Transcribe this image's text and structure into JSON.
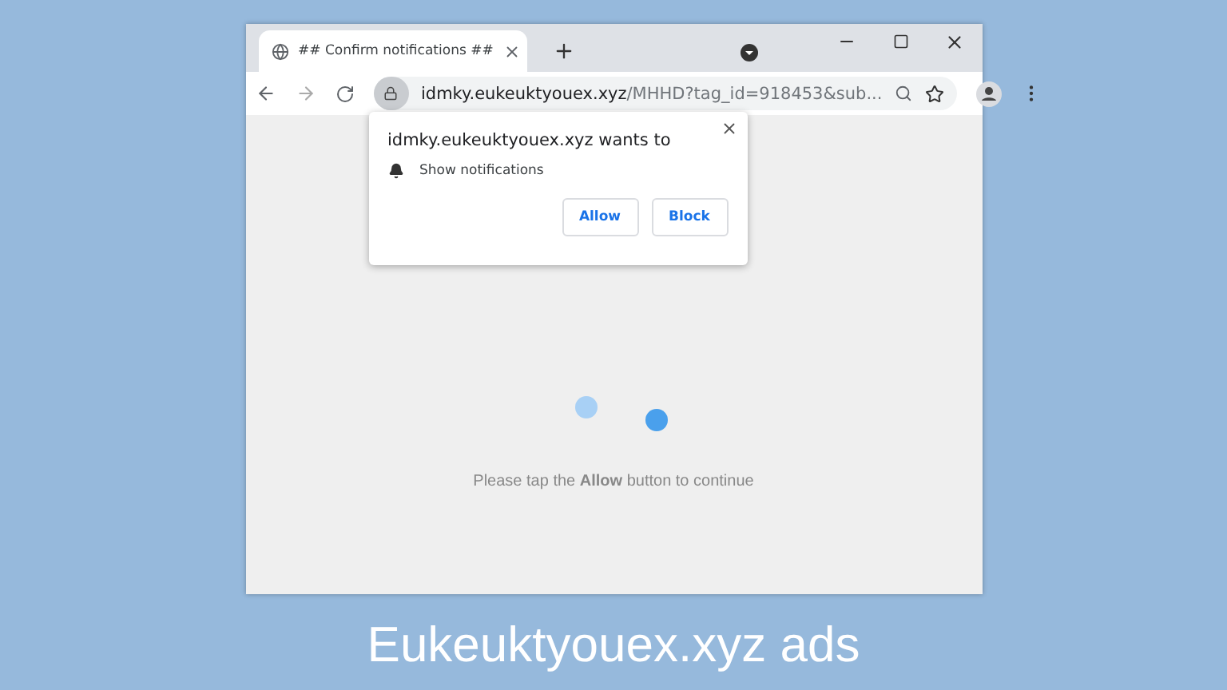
{
  "tab": {
    "title": "## Confirm notifications ##",
    "selected": true
  },
  "address_bar": {
    "host": "idmky.eukeuktyouex.xyz",
    "path": "/MHHD?tag_id=918453&sub..."
  },
  "permission_popup": {
    "title": "idmky.eukeuktyouex.xyz wants to",
    "permission": "Show notifications",
    "buttons": [
      "Allow",
      "Block"
    ]
  },
  "page": {
    "message": "Please tap the **Allow** button to continue"
  },
  "caption": "Eukeuktyouex.xyz ads"
}
